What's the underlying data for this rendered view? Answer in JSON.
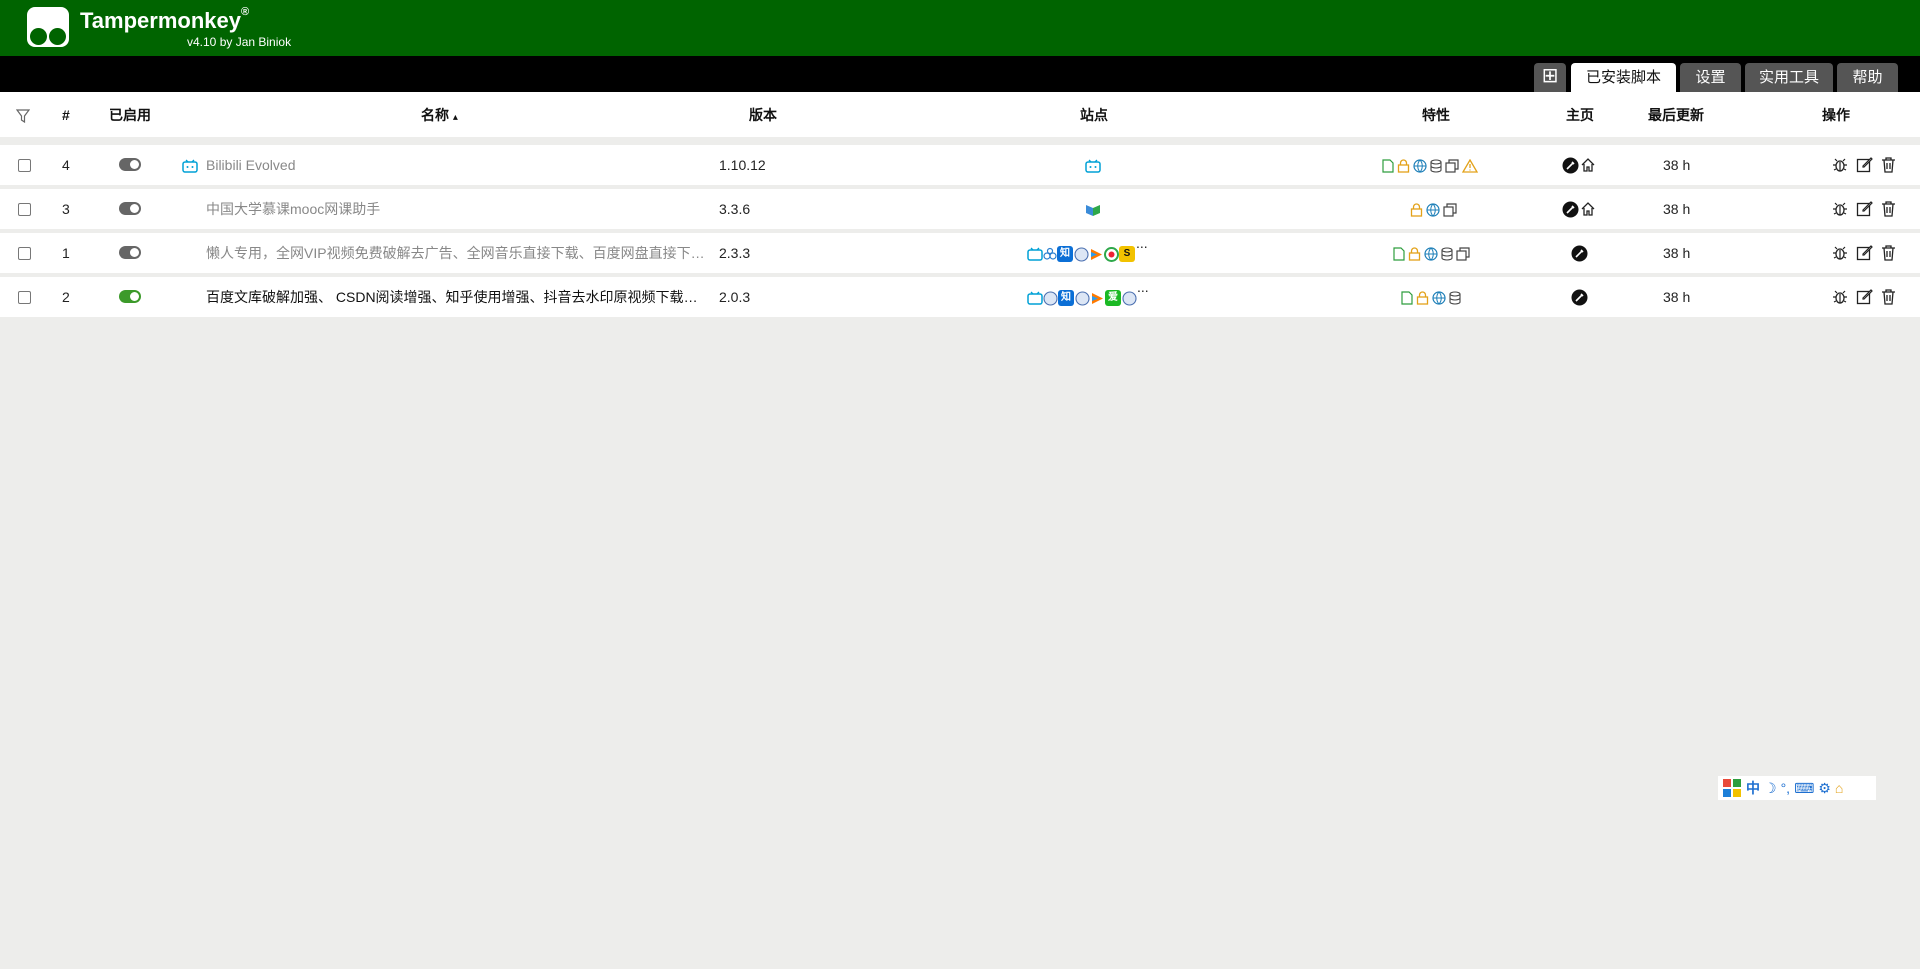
{
  "app": {
    "title": "Tampermonkey",
    "trademark": "®",
    "byline": "v4.10 by Jan Biniok"
  },
  "tabs": [
    {
      "label": "已安装脚本",
      "active": true
    },
    {
      "label": "设置",
      "active": false
    },
    {
      "label": "实用工具",
      "active": false
    },
    {
      "label": "帮助",
      "active": false
    }
  ],
  "new_tab_symbol": "⊞",
  "table": {
    "columns": {
      "index": "#",
      "enabled": "已启用",
      "name": "名称",
      "sort_indicator": "▴",
      "version": "版本",
      "sites": "站点",
      "features": "特性",
      "homepage": "主页",
      "updated": "最后更新",
      "actions": "操作"
    },
    "rows": [
      {
        "index": "4",
        "enabled": false,
        "name": "Bilibili Evolved",
        "version": "1.10.12",
        "updated": "38 h",
        "more": ""
      },
      {
        "index": "3",
        "enabled": false,
        "name": "中国大学慕课mooc网课助手",
        "version": "3.3.6",
        "updated": "38 h",
        "more": ""
      },
      {
        "index": "1",
        "enabled": false,
        "name": "懒人专用，全网VIP视频免费破解去广告、全网音乐直接下载、百度网盘直接下载...",
        "version": "2.3.3",
        "updated": "38 h",
        "more": "..."
      },
      {
        "index": "2",
        "enabled": true,
        "name": "百度文库破解加强、 CSDN阅读增强、知乎使用增强、抖音去水印原视频下载、全...",
        "version": "2.0.3",
        "updated": "38 h",
        "more": "..."
      }
    ]
  },
  "site_glyphs": {
    "zhihu": "知",
    "sohu": "S",
    "iqiyi": "爱"
  },
  "ime_bar": {
    "lang": "中",
    "moon": "☽",
    "punct": "°,",
    "keyboard": "⌨",
    "gear": "⚙",
    "home": "⌂"
  },
  "colors": {
    "header": "#006400",
    "tabbar": "#000000",
    "toggle_on": "#3c9a2a",
    "bilibili": "#00a1d6"
  }
}
